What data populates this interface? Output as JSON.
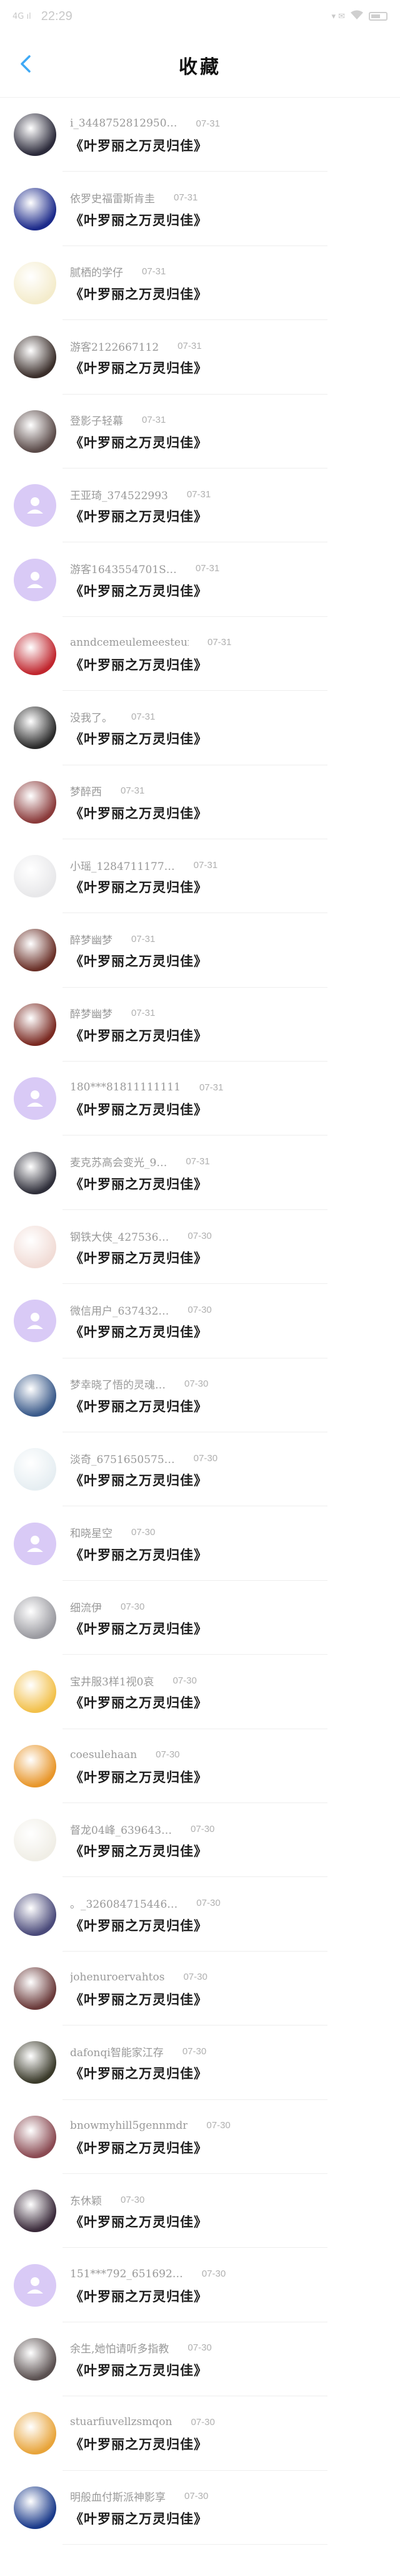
{
  "status_bar": {
    "signal": "4G ıl",
    "time": "22:29",
    "right_icons": "▾ ✉",
    "battery_label": "battery"
  },
  "header": {
    "title": "收藏"
  },
  "colors": {
    "default_avatar_bg": "#d9caf6",
    "back_arrow": "#3fa9f5"
  },
  "items": [
    {
      "nickname": "i_3448752812950…",
      "date": "07-31",
      "title": "《叶罗丽之万灵归佳》",
      "avatar": "photo",
      "avatar_color": "#2b2a3a"
    },
    {
      "nickname": "依罗史福雷斯肯圭",
      "date": "07-31",
      "title": "《叶罗丽之万灵归佳》",
      "avatar": "photo",
      "avatar_color": "#1c2a8a"
    },
    {
      "nickname": "腻栖的学仔",
      "date": "07-31",
      "title": "《叶罗丽之万灵归佳》",
      "avatar": "photo",
      "avatar_color": "#f4eccc"
    },
    {
      "nickname": "游客2122667112",
      "date": "07-31",
      "title": "《叶罗丽之万灵归佳》",
      "avatar": "photo",
      "avatar_color": "#3a2e2a"
    },
    {
      "nickname": "登影子轻幕",
      "date": "07-31",
      "title": "《叶罗丽之万灵归佳》",
      "avatar": "photo",
      "avatar_color": "#5a4a48"
    },
    {
      "nickname": "王亚琦_374522993",
      "date": "07-31",
      "title": "《叶罗丽之万灵归佳》",
      "avatar": "default",
      "avatar_color": "#d9caf6"
    },
    {
      "nickname": "游客1643554701S…",
      "date": "07-31",
      "title": "《叶罗丽之万灵归佳》",
      "avatar": "default",
      "avatar_color": "#d9caf6"
    },
    {
      "nickname": "anndcemeulemeesteura",
      "date": "07-31",
      "title": "《叶罗丽之万灵归佳》",
      "avatar": "photo",
      "avatar_color": "#c0262e"
    },
    {
      "nickname": "没我了。",
      "date": "07-31",
      "title": "《叶罗丽之万灵归佳》",
      "avatar": "photo",
      "avatar_color": "#2a2a2a"
    },
    {
      "nickname": "梦醉西",
      "date": "07-31",
      "title": "《叶罗丽之万灵归佳》",
      "avatar": "photo",
      "avatar_color": "#8a3a3a"
    },
    {
      "nickname": "小瑶_1284711177…",
      "date": "07-31",
      "title": "《叶罗丽之万灵归佳》",
      "avatar": "photo",
      "avatar_color": "#e8e8ea"
    },
    {
      "nickname": "醉梦幽梦",
      "date": "07-31",
      "title": "《叶罗丽之万灵归佳》",
      "avatar": "photo",
      "avatar_color": "#6a3028"
    },
    {
      "nickname": "醉梦幽梦",
      "date": "07-31",
      "title": "《叶罗丽之万灵归佳》",
      "avatar": "photo",
      "avatar_color": "#7a2a22"
    },
    {
      "nickname": "180***81811111111",
      "date": "07-31",
      "title": "《叶罗丽之万灵归佳》",
      "avatar": "default",
      "avatar_color": "#d9caf6"
    },
    {
      "nickname": "麦克苏高会变光_9…",
      "date": "07-31",
      "title": "《叶罗丽之万灵归佳》",
      "avatar": "photo",
      "avatar_color": "#2f2f3a"
    },
    {
      "nickname": "钢铁大侠_427536…",
      "date": "07-30",
      "title": "《叶罗丽之万灵归佳》",
      "avatar": "photo",
      "avatar_color": "#f1dcd6"
    },
    {
      "nickname": "微信用户_637432…",
      "date": "07-30",
      "title": "《叶罗丽之万灵归佳》",
      "avatar": "default",
      "avatar_color": "#d9caf6"
    },
    {
      "nickname": "梦幸晓了悟的灵魂…",
      "date": "07-30",
      "title": "《叶罗丽之万灵归佳》",
      "avatar": "photo",
      "avatar_color": "#3a5a8a"
    },
    {
      "nickname": "淡奇_6751650575…",
      "date": "07-30",
      "title": "《叶罗丽之万灵归佳》",
      "avatar": "photo",
      "avatar_color": "#e6eef2"
    },
    {
      "nickname": "和晓星空",
      "date": "07-30",
      "title": "《叶罗丽之万灵归佳》",
      "avatar": "default",
      "avatar_color": "#d9caf6"
    },
    {
      "nickname": "细流伊",
      "date": "07-30",
      "title": "《叶罗丽之万灵归佳》",
      "avatar": "photo",
      "avatar_color": "#9a9aa0"
    },
    {
      "nickname": "宝井服3样1视0哀",
      "date": "07-30",
      "title": "《叶罗丽之万灵归佳》",
      "avatar": "photo",
      "avatar_color": "#f2c04a"
    },
    {
      "nickname": "coesulehaan",
      "date": "07-30",
      "title": "《叶罗丽之万灵归佳》",
      "avatar": "photo",
      "avatar_color": "#e8962a"
    },
    {
      "nickname": "督龙04峰_639643…",
      "date": "07-30",
      "title": "《叶罗丽之万灵归佳》",
      "avatar": "photo",
      "avatar_color": "#f0eee6"
    },
    {
      "nickname": "。_326084715446…",
      "date": "07-30",
      "title": "《叶罗丽之万灵归佳》",
      "avatar": "photo",
      "avatar_color": "#4a4a7a"
    },
    {
      "nickname": "johenuroervahtos",
      "date": "07-30",
      "title": "《叶罗丽之万灵归佳》",
      "avatar": "photo",
      "avatar_color": "#6a3a3a"
    },
    {
      "nickname": "dafonqi智能家江存",
      "date": "07-30",
      "title": "《叶罗丽之万灵归佳》",
      "avatar": "photo",
      "avatar_color": "#3a3a2a"
    },
    {
      "nickname": "bnowmyhill5gennmdr",
      "date": "07-30",
      "title": "《叶罗丽之万灵归佳》",
      "avatar": "photo",
      "avatar_color": "#8a4a52"
    },
    {
      "nickname": "东休颖",
      "date": "07-30",
      "title": "《叶罗丽之万灵归佳》",
      "avatar": "photo",
      "avatar_color": "#3a2a3a"
    },
    {
      "nickname": "151***792_651692…",
      "date": "07-30",
      "title": "《叶罗丽之万灵归佳》",
      "avatar": "default",
      "avatar_color": "#d9caf6"
    },
    {
      "nickname": "余生,她怕请听多指教",
      "date": "07-30",
      "title": "《叶罗丽之万灵归佳》",
      "avatar": "photo",
      "avatar_color": "#5a5050"
    },
    {
      "nickname": "stuarfiuvellzsmqon",
      "date": "07-30",
      "title": "《叶罗丽之万灵归佳》",
      "avatar": "photo",
      "avatar_color": "#e8a43a"
    },
    {
      "nickname": "明般血付斯派神影享",
      "date": "07-30",
      "title": "《叶罗丽之万灵归佳》",
      "avatar": "photo",
      "avatar_color": "#1a3a8a"
    }
  ]
}
